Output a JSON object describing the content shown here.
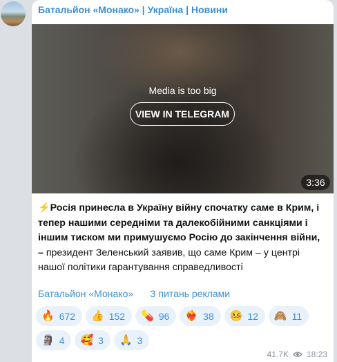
{
  "channel": {
    "name": "Батальйон «Монако» | Україна | Новини"
  },
  "media": {
    "note": "Media is too big",
    "button_label": "VIEW IN TELEGRAM",
    "duration": "3:36"
  },
  "post": {
    "bolt": "⚡️",
    "bold_text": "Росія принесла в Україну війну спочатку саме в Крим, і тепер нашими середніми та далекобійними санкціями і іншим тиском ми примушуємо Росію до закінчення війни, –",
    "rest_text": " президент Зеленський заявив, що саме Крим – у центрі нашої політики гарантування справедливості"
  },
  "links": {
    "channel_link": "Батальйон «Монако»",
    "ads_link": "З питань реклами"
  },
  "reactions": [
    {
      "emoji": "🔥",
      "count": "672"
    },
    {
      "emoji": "👍",
      "count": "152"
    },
    {
      "emoji": "💊",
      "count": "96"
    },
    {
      "emoji": "❤️‍🔥",
      "count": "38"
    },
    {
      "emoji": "🤒",
      "count": "12"
    },
    {
      "emoji": "🙈",
      "count": "11"
    },
    {
      "emoji": "🗿",
      "count": "4"
    },
    {
      "emoji": "🥰",
      "count": "3"
    },
    {
      "emoji": "🙏",
      "count": "3"
    }
  ],
  "footer": {
    "views": "41.7K",
    "time": "18:23"
  },
  "colors": {
    "accent": "#3d8fd1",
    "reaction_bg": "#e9f2fb"
  }
}
